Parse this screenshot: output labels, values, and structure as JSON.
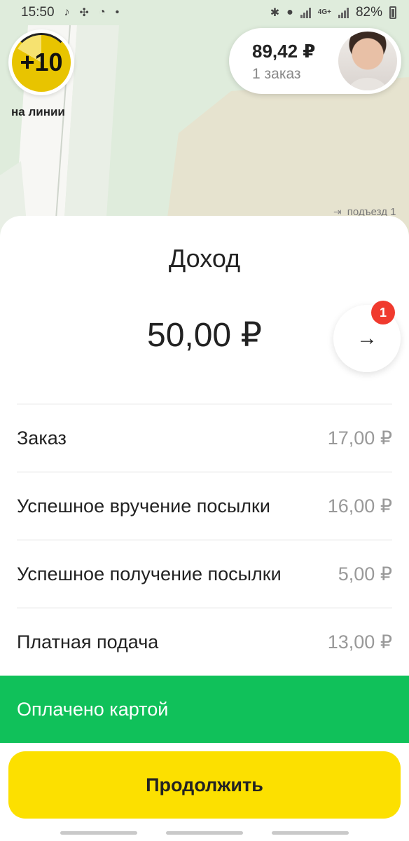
{
  "status_bar": {
    "time": "15:50",
    "network": "4G+",
    "battery": "82%"
  },
  "rating": {
    "value": "+10",
    "label": "на линии"
  },
  "balance": {
    "amount": "89,42 ₽",
    "orders": "1 заказ"
  },
  "map": {
    "entrance_label": "подъезд 1"
  },
  "income": {
    "title": "Доход",
    "total": "50,00 ₽",
    "notifications": "1",
    "items": [
      {
        "label": "Заказ",
        "value": "17,00 ₽"
      },
      {
        "label": "Успешное вручение посылки",
        "value": "16,00 ₽"
      },
      {
        "label": "Успешное получение посылки",
        "value": "5,00 ₽"
      },
      {
        "label": "Платная подача",
        "value": "13,00 ₽"
      }
    ]
  },
  "payment": {
    "status": "Оплачено картой"
  },
  "actions": {
    "continue": "Продолжить"
  },
  "colors": {
    "accent_yellow": "#fce000",
    "paid_green": "#10c15a",
    "badge_red": "#f03a2e"
  }
}
